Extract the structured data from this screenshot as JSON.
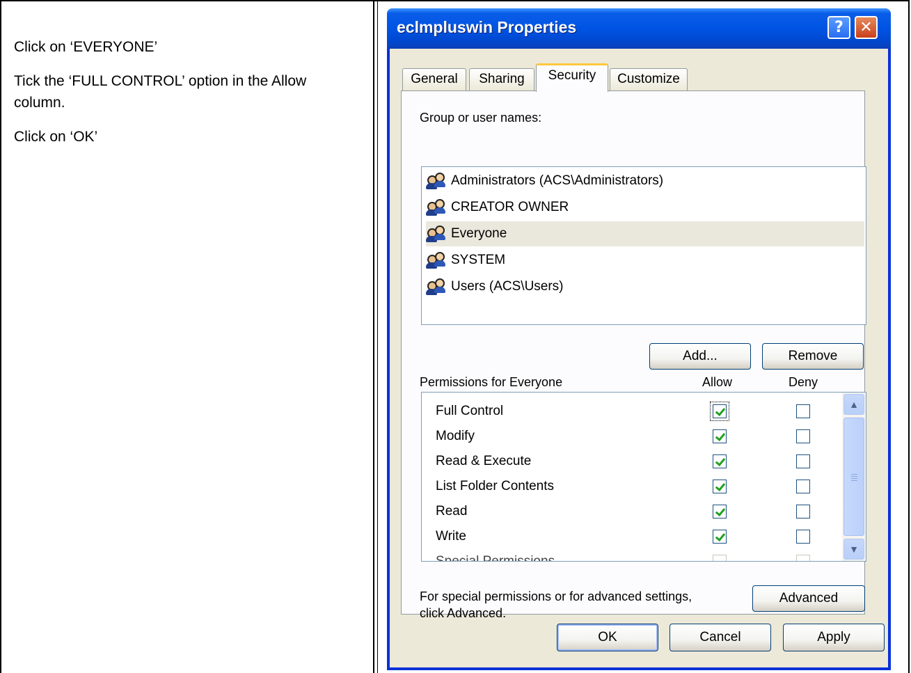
{
  "instructions": [
    "Click on ‘EVERYONE’",
    "Tick the ‘FULL CONTROL’ option in the Allow column.",
    "Click on ‘OK’"
  ],
  "dialog": {
    "title": "eclmpluswin Properties",
    "help_glyph": "?",
    "close_glyph": "✕",
    "tabs": [
      "General",
      "Sharing",
      "Security",
      "Customize"
    ],
    "active_tab": "Security",
    "group_label": "Group or user names:",
    "users": [
      {
        "name": "Administrators (ACS\\Administrators)",
        "selected": false
      },
      {
        "name": "CREATOR OWNER",
        "selected": false
      },
      {
        "name": "Everyone",
        "selected": true
      },
      {
        "name": "SYSTEM",
        "selected": false
      },
      {
        "name": "Users (ACS\\Users)",
        "selected": false
      }
    ],
    "add_label": "Add...",
    "remove_label": "Remove",
    "permissions_label": "Permissions for Everyone",
    "allow_header": "Allow",
    "deny_header": "Deny",
    "permissions": [
      {
        "name": "Full Control",
        "allow": true,
        "deny": false
      },
      {
        "name": "Modify",
        "allow": true,
        "deny": false
      },
      {
        "name": "Read & Execute",
        "allow": true,
        "deny": false
      },
      {
        "name": "List Folder Contents",
        "allow": true,
        "deny": false
      },
      {
        "name": "Read",
        "allow": true,
        "deny": false
      },
      {
        "name": "Write",
        "allow": true,
        "deny": false
      },
      {
        "name": "Special Permissions",
        "allow": false,
        "deny": false
      }
    ],
    "advanced_text_1": "For special permissions or for advanced settings,",
    "advanced_text_2": "click Advanced.",
    "advanced_label": "Advanced",
    "ok_label": "OK",
    "cancel_label": "Cancel",
    "apply_label": "Apply"
  }
}
